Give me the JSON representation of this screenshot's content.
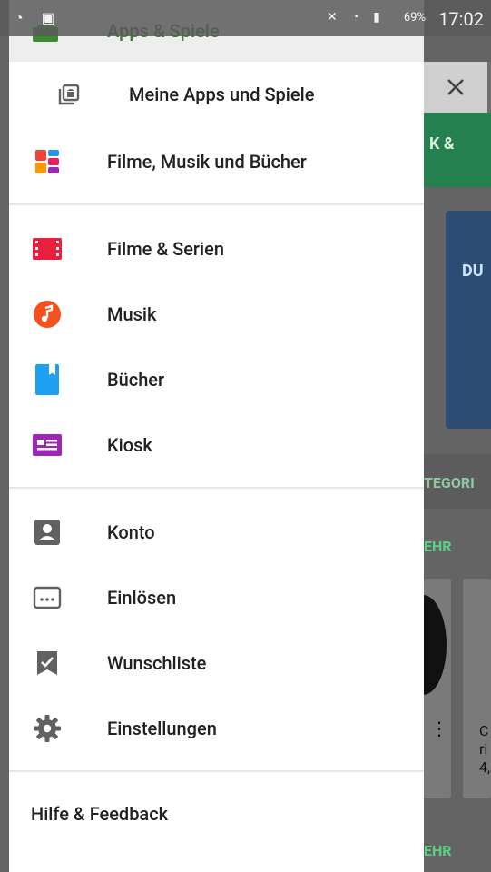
{
  "status_bar": {
    "battery": "69%",
    "time": "17:02"
  },
  "drawer": {
    "header_title": "Apps & Spiele",
    "sections": [
      {
        "items": [
          {
            "label": "Meine Apps und Spiele",
            "icon": "my-apps-icon"
          },
          {
            "label": "Filme, Musik und Bücher",
            "icon": "entertainment-icon"
          }
        ]
      },
      {
        "items": [
          {
            "label": "Filme & Serien",
            "icon": "movies-icon",
            "color": "#e8203e"
          },
          {
            "label": "Musik",
            "icon": "music-icon",
            "color": "#f4511e"
          },
          {
            "label": "Bücher",
            "icon": "books-icon",
            "color": "#1ea0f2"
          },
          {
            "label": "Kiosk",
            "icon": "newsstand-icon",
            "color": "#9c27b0"
          }
        ]
      },
      {
        "items": [
          {
            "label": "Konto",
            "icon": "account-icon"
          },
          {
            "label": "Einlösen",
            "icon": "redeem-icon"
          },
          {
            "label": "Wunschliste",
            "icon": "wishlist-icon"
          },
          {
            "label": "Einstellungen",
            "icon": "settings-icon"
          }
        ]
      }
    ],
    "help_label": "Hilfe & Feedback"
  },
  "background": {
    "tab_text": "K &",
    "card_text": "DU",
    "kategorie_text": "TEGORI",
    "mehr_1": "EHR",
    "mehr_2": "EHR",
    "card_text_2": "C ri 4,"
  }
}
